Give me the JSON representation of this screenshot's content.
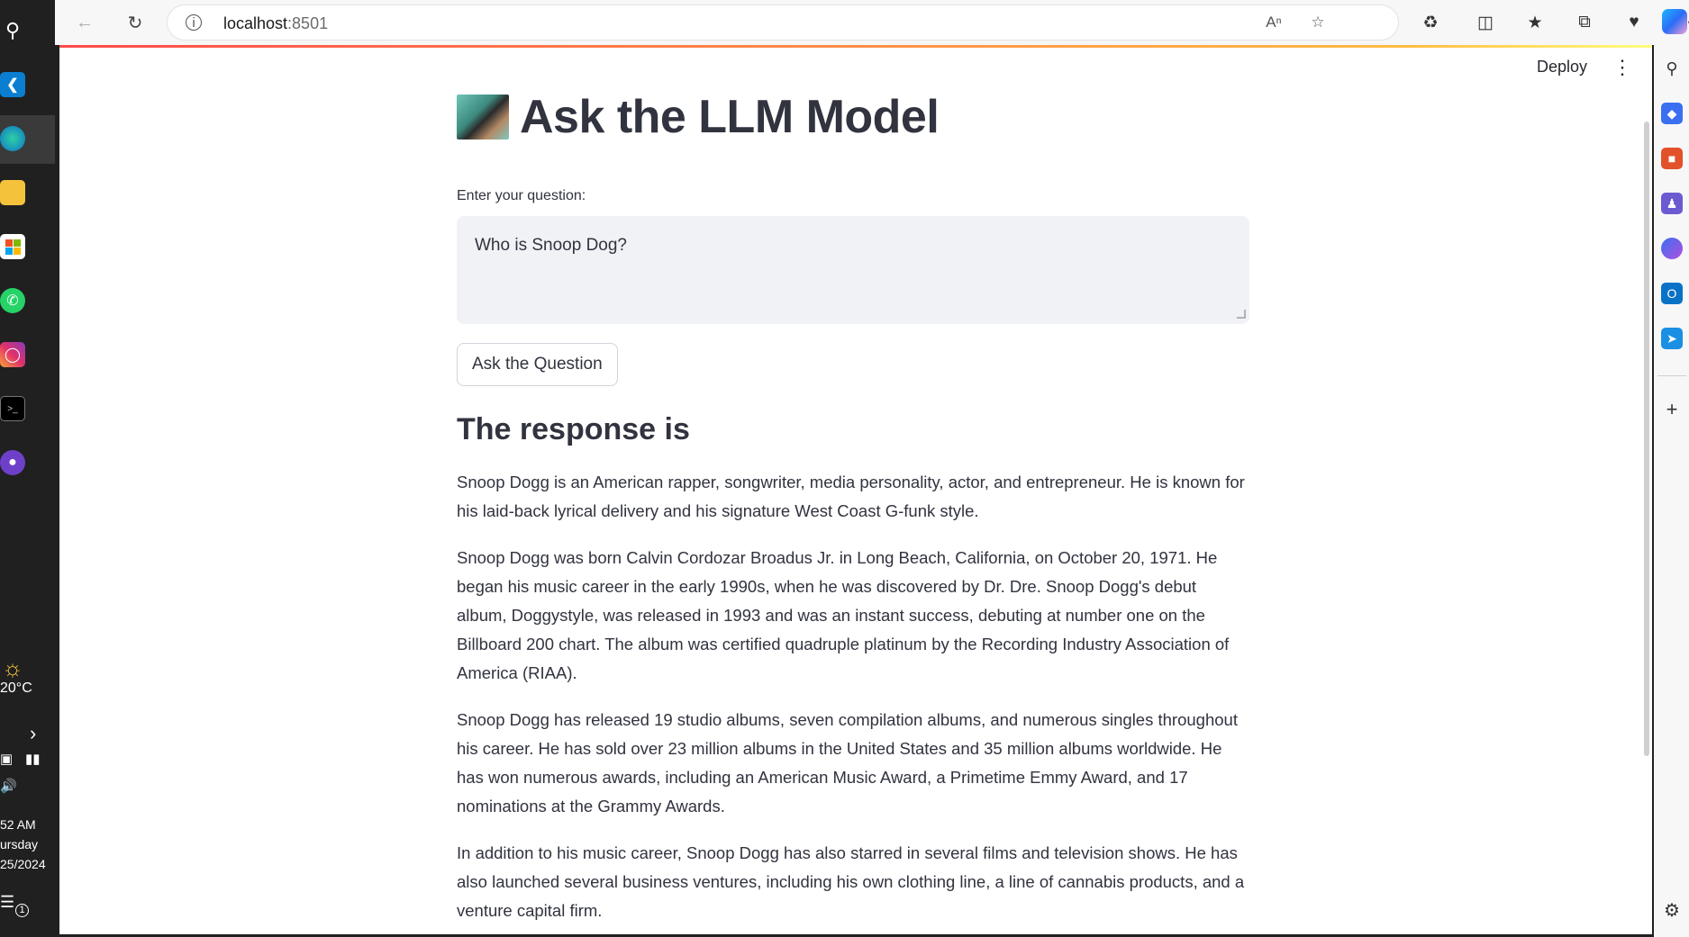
{
  "browser": {
    "url_host": "localhost",
    "url_port": ":8501"
  },
  "taskbar": {
    "weather_temp": "20°C",
    "time": "52 AM",
    "day": "ursday",
    "date": "25/2024",
    "notification_count": "1"
  },
  "app": {
    "deploy_label": "Deploy",
    "title": "Ask the LLM Model",
    "question_label": "Enter your question:",
    "question_value": "Who is Snoop Dog?",
    "ask_button_label": "Ask the Question",
    "response_heading": "The response is",
    "response_paragraphs": [
      "Snoop Dogg is an American rapper, songwriter, media personality, actor, and entrepreneur. He is known for his laid-back lyrical delivery and his signature West Coast G-funk style.",
      "Snoop Dogg was born Calvin Cordozar Broadus Jr. in Long Beach, California, on October 20, 1971. He began his music career in the early 1990s, when he was discovered by Dr. Dre. Snoop Dogg's debut album, Doggystyle, was released in 1993 and was an instant success, debuting at number one on the Billboard 200 chart. The album was certified quadruple platinum by the Recording Industry Association of America (RIAA).",
      "Snoop Dogg has released 19 studio albums, seven compilation albums, and numerous singles throughout his career. He has sold over 23 million albums in the United States and 35 million albums worldwide. He has won numerous awards, including an American Music Award, a Primetime Emmy Award, and 17 nominations at the Grammy Awards.",
      "In addition to his music career, Snoop Dogg has also starred in several films and television shows. He has also launched several business ventures, including his own clothing line, a line of cannabis products, and a venture capital firm."
    ]
  }
}
